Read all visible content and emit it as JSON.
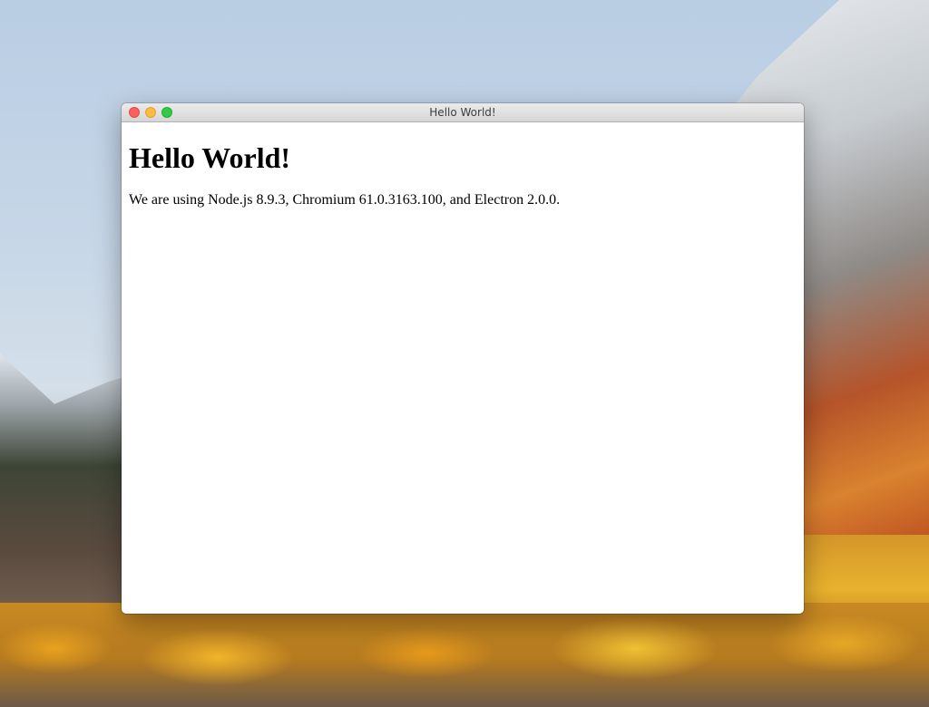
{
  "window": {
    "title": "Hello World!",
    "traffic_lights": {
      "close_color": "#fc605c",
      "minimize_color": "#fdbc40",
      "maximize_color": "#34c84a"
    }
  },
  "content": {
    "heading": "Hello World!",
    "body_text": "We are using Node.js 8.9.3, Chromium 61.0.3163.100, and Electron 2.0.0."
  }
}
